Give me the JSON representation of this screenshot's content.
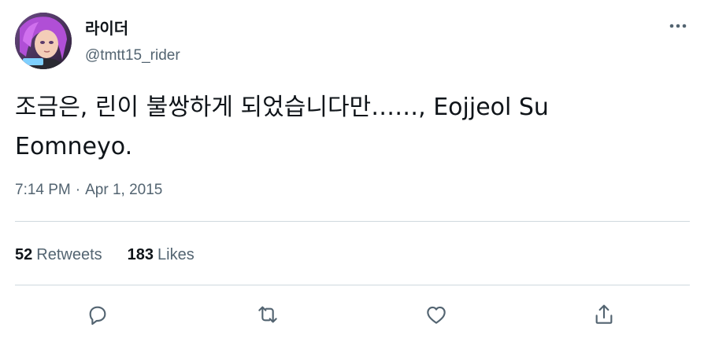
{
  "author": {
    "display_name": "라이더",
    "handle": "@tmtt15_rider"
  },
  "tweet": {
    "text": "조금은, 린이 불쌍하게 되었습니다만……, Eojjeol Su Eomneyo."
  },
  "meta": {
    "time": "7:14 PM",
    "separator": "·",
    "date": "Apr 1, 2015"
  },
  "stats": {
    "retweets_count": "52",
    "retweets_label": "Retweets",
    "likes_count": "183",
    "likes_label": "Likes"
  },
  "actions": [
    {
      "icon": "reply-icon"
    },
    {
      "icon": "retweet-icon"
    },
    {
      "icon": "like-icon"
    },
    {
      "icon": "share-icon"
    }
  ],
  "colors": {
    "text_primary": "#0f1419",
    "text_secondary": "#536471",
    "divider": "#cfd9de"
  }
}
